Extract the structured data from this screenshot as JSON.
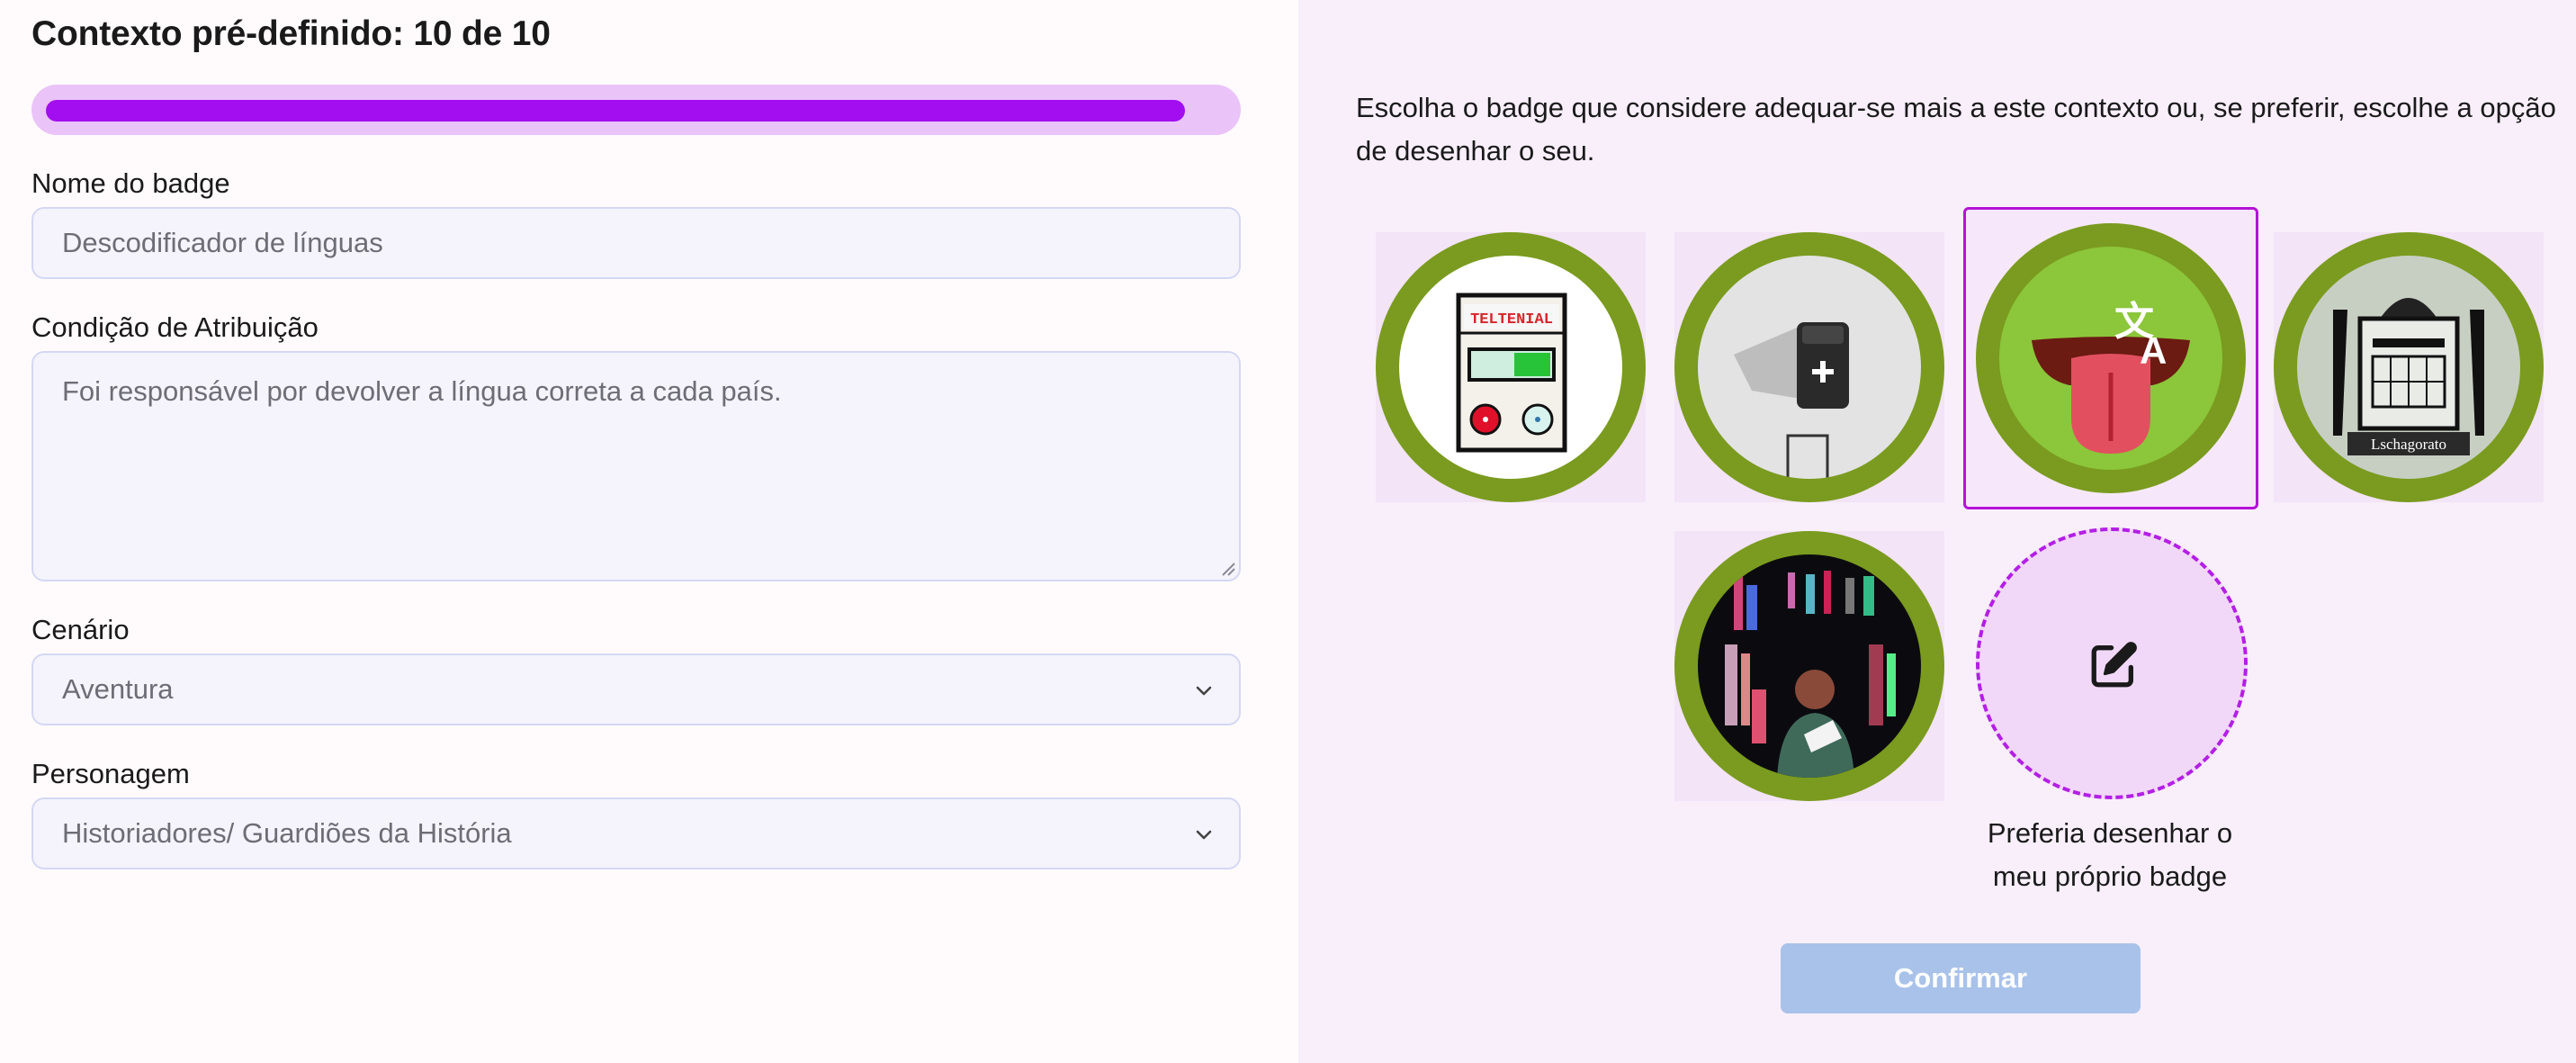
{
  "header": {
    "title": "Contexto pré-definido: 10 de 10",
    "progress": 0.965
  },
  "form": {
    "badge_name": {
      "label": "Nome do badge",
      "value": "Descodificador de línguas"
    },
    "condition": {
      "label": "Condição de Atribuição",
      "value": "Foi responsável por devolver a língua correta a cada país."
    },
    "scenario": {
      "label": "Cenário",
      "selected": "Aventura"
    },
    "character": {
      "label": "Personagem",
      "selected": "Historiadores/ Guardiões da História"
    }
  },
  "badges": {
    "instructions": "Escolha o badge que considere adequar-se mais a este contexto ou, se preferir, escolhe a opção de desenhar o seu.",
    "options": [
      {
        "icon": "device-card-icon",
        "text": "TELTENIAL",
        "selected": false
      },
      {
        "icon": "plus-block-icon",
        "selected": false
      },
      {
        "icon": "tongue-translate-icon",
        "selected": true
      },
      {
        "icon": "machine-engraving-icon",
        "text": "Lschagorato",
        "selected": false
      },
      {
        "icon": "bookshelf-figure-icon",
        "selected": false
      }
    ],
    "draw_own": {
      "icon": "edit-icon",
      "caption_line1": "Preferia desenhar o",
      "caption_line2": "meu próprio badge"
    },
    "confirm_label": "Confirmar"
  },
  "colors": {
    "accent": "#a20ef0",
    "progress_track": "#eac3f9",
    "badge_ring": "#7a9b1f",
    "selected_border": "#b512d6",
    "right_panel_bg": "#f8effb",
    "confirm_disabled": "#a9c2ea"
  }
}
